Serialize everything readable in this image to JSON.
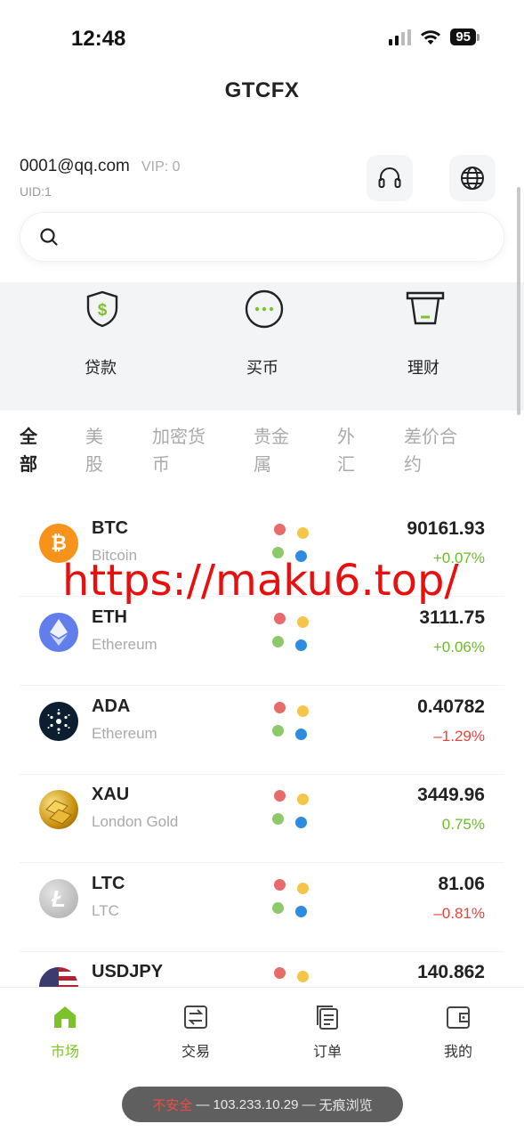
{
  "status_bar": {
    "time": "12:48",
    "battery": "95"
  },
  "app": {
    "title": "GTCFX"
  },
  "user": {
    "email": "0001@qq.com",
    "vip": "VIP: 0",
    "uid": "UID:1"
  },
  "search": {
    "placeholder": ""
  },
  "quick_menu": [
    {
      "label": "贷款",
      "icon": "shield-dollar-icon"
    },
    {
      "label": "买币",
      "icon": "chat-dots-icon"
    },
    {
      "label": "理财",
      "icon": "atm-card-icon"
    }
  ],
  "tabs": [
    {
      "label": "全部",
      "active": true
    },
    {
      "label": "美股"
    },
    {
      "label": "加密货币"
    },
    {
      "label": "贵金属"
    },
    {
      "label": "外汇"
    },
    {
      "label": "差价合约"
    }
  ],
  "market": [
    {
      "symbol": "BTC",
      "name": "Bitcoin",
      "price": "90161.93",
      "change": "+0.07%",
      "direction": "up",
      "logo_color": "#f7931a"
    },
    {
      "symbol": "ETH",
      "name": "Ethereum",
      "price": "3111.75",
      "change": "+0.06%",
      "direction": "up",
      "logo_color": "#627eea"
    },
    {
      "symbol": "ADA",
      "name": "Ethereum",
      "price": "0.40782",
      "change": "–1.29%",
      "direction": "down",
      "logo_color": "#0d1e30"
    },
    {
      "symbol": "XAU",
      "name": "London Gold",
      "price": "3449.96",
      "change": "0.75%",
      "direction": "up",
      "logo_color": "#d4a017"
    },
    {
      "symbol": "LTC",
      "name": "LTC",
      "price": "81.06",
      "change": "–0.81%",
      "direction": "down",
      "logo_color": "#b8b8b8"
    },
    {
      "symbol": "USDJPY",
      "name": "",
      "price": "140.862",
      "change": "",
      "direction": "up",
      "logo_color": "#b22234"
    }
  ],
  "watermark": "https://maku6.top/",
  "bottom_nav": [
    {
      "label": "市场",
      "icon": "home-icon",
      "active": true
    },
    {
      "label": "交易",
      "icon": "exchange-icon"
    },
    {
      "label": "订单",
      "icon": "orders-icon"
    },
    {
      "label": "我的",
      "icon": "wallet-icon"
    }
  ],
  "browser": {
    "insecure": "不安全",
    "address": "— 103.233.10.29 —",
    "mode": "无痕浏览"
  },
  "colors": {
    "accent": "#7cc22a",
    "up": "#6dbb2b",
    "down": "#e5443c",
    "dot_red": "#e86b6b",
    "dot_yellow": "#f4c54b",
    "dot_green": "#8bc96a",
    "dot_blue": "#2d8be0"
  }
}
